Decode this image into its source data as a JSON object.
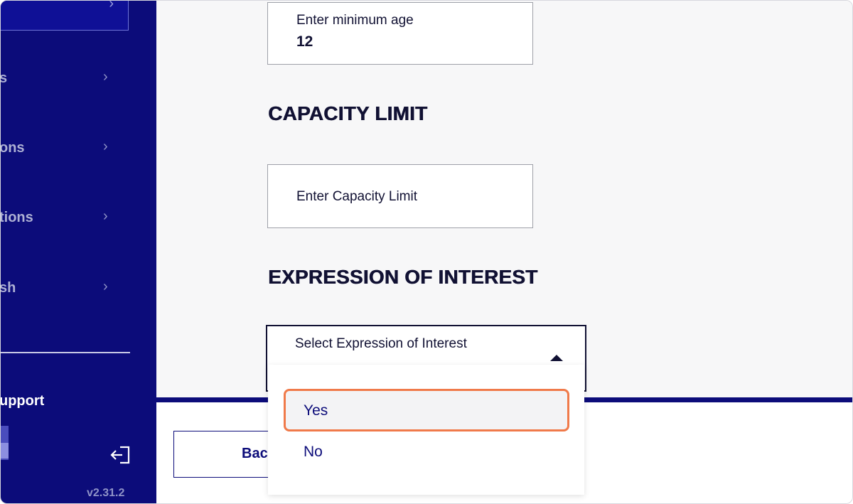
{
  "sidebar": {
    "items": [
      {
        "label": "s"
      },
      {
        "label": "ons"
      },
      {
        "label": "tions"
      },
      {
        "label": "sh"
      }
    ],
    "support_label": "upport",
    "version": "v2.31.2"
  },
  "form": {
    "min_age": {
      "label": "Enter minimum age",
      "value": "12"
    },
    "capacity": {
      "title": "CAPACITY LIMIT",
      "placeholder": "Enter Capacity Limit"
    },
    "interest": {
      "title": "EXPRESSION OF INTEREST",
      "placeholder": "Select Expression of Interest",
      "options": [
        {
          "label": "Yes"
        },
        {
          "label": "No"
        }
      ]
    }
  },
  "footer": {
    "back_label": "Bac"
  },
  "colors": {
    "sidebar": "#0c0c7a",
    "highlight": "#f07a4a",
    "text": "#111133"
  }
}
